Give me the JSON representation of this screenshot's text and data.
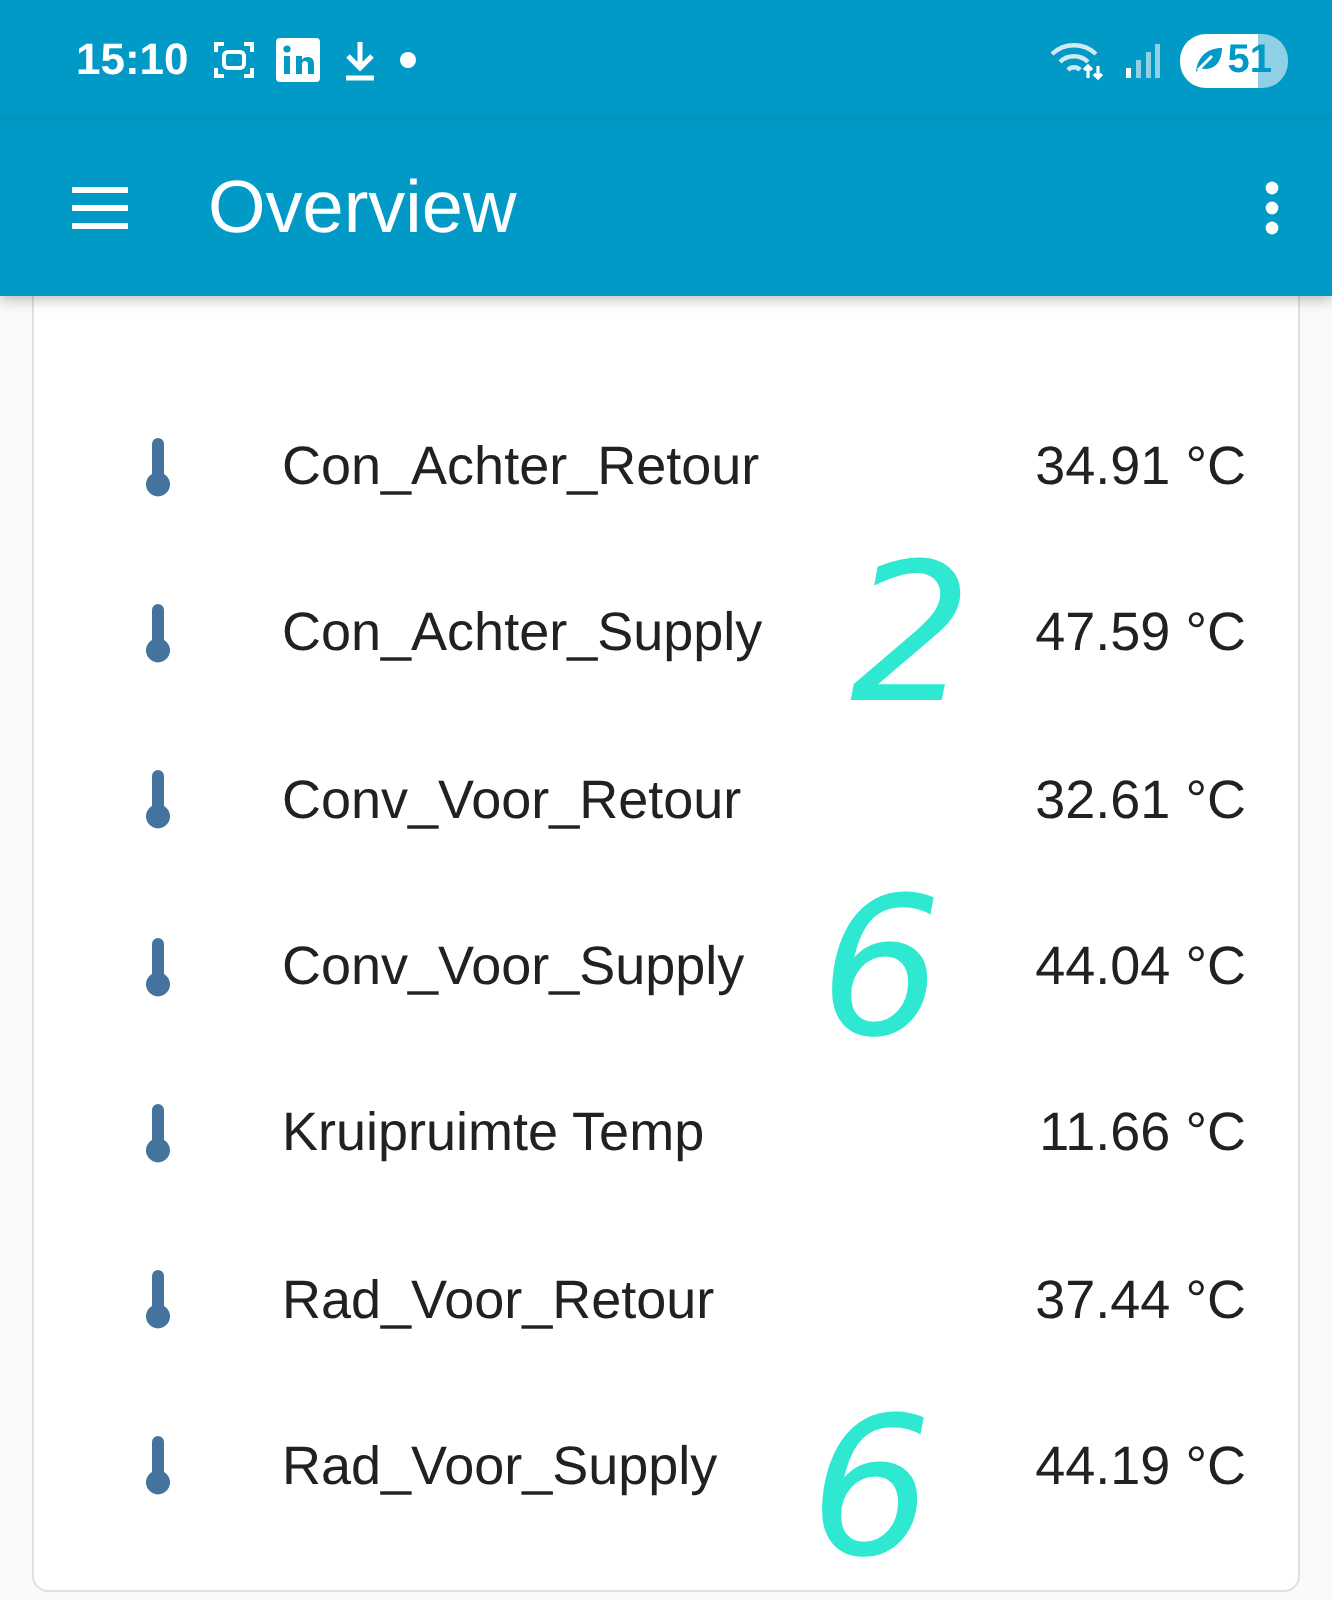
{
  "status_bar": {
    "time": "15:10",
    "battery": "51"
  },
  "app_bar": {
    "title": "Overview"
  },
  "entities": [
    {
      "name": "Con_Achter_Retour",
      "state": "34.91 °C"
    },
    {
      "name": "Con_Achter_Supply",
      "state": "47.59 °C"
    },
    {
      "name": "Conv_Voor_Retour",
      "state": "32.61 °C"
    },
    {
      "name": "Conv_Voor_Supply",
      "state": "44.04 °C"
    },
    {
      "name": "Kruipruimte Temp",
      "state": "11.66 °C"
    },
    {
      "name": "Rad_Voor_Retour",
      "state": "37.44 °C"
    },
    {
      "name": "Rad_Voor_Supply",
      "state": "44.19 °C"
    }
  ],
  "annotations": [
    {
      "text": "2"
    },
    {
      "text": "6"
    },
    {
      "text": "6"
    }
  ]
}
